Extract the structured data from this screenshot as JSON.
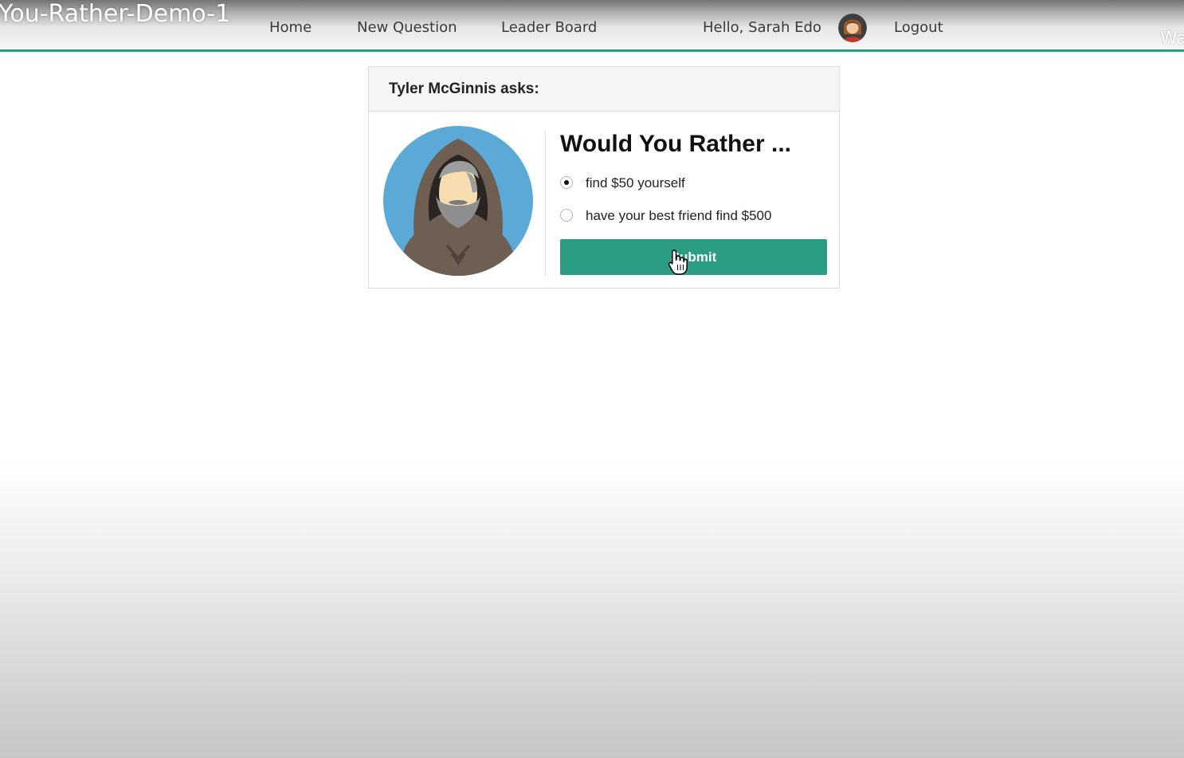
{
  "video": {
    "title": "You-Rather-Demo-1",
    "watermark": "Wa"
  },
  "nav": {
    "home": "Home",
    "new_question": "New Question",
    "leader_board": "Leader Board",
    "greeting": "Hello, Sarah Edo",
    "logout": "Logout",
    "user_avatar_icon": "woman-avatar-icon",
    "accent_color": "#2b9c86"
  },
  "question": {
    "header": "Tyler McGinnis asks:",
    "author_avatar_icon": "hooded-bearded-man-avatar-icon",
    "title": "Would You Rather ...",
    "options": [
      {
        "label": "find $50 yourself",
        "selected": true
      },
      {
        "label": "have your best friend find $500",
        "selected": false
      }
    ],
    "submit_label": "Submit",
    "button_color": "#2a9d84"
  },
  "cursor": {
    "icon": "hand-pointer-icon"
  }
}
